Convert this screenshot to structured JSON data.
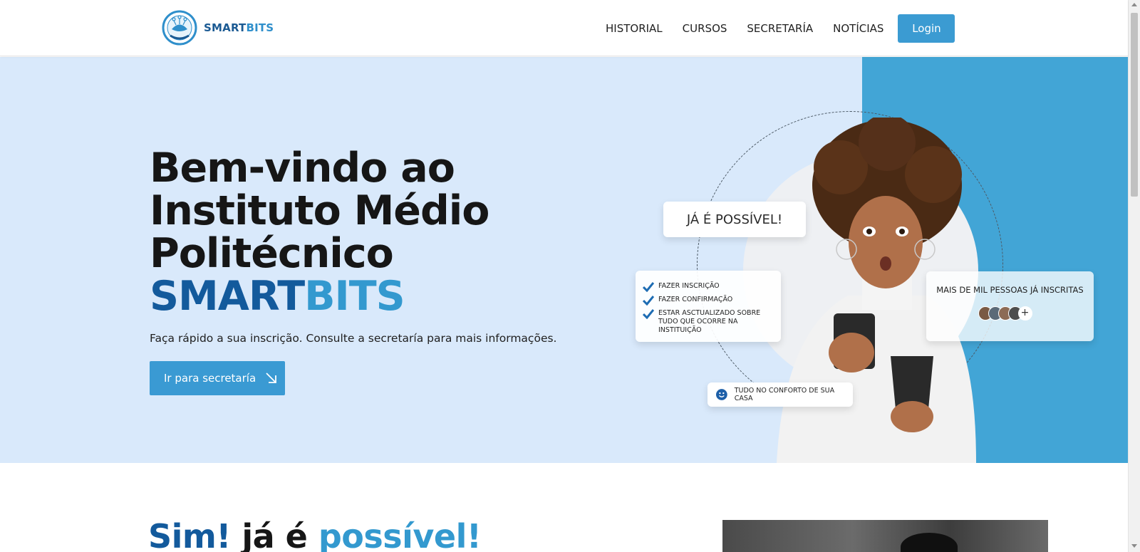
{
  "brand": {
    "name_part1": "SMART",
    "name_part2": "BITS",
    "logo_icon": "smartbits-logo-icon"
  },
  "nav": {
    "items": [
      "HISTORIAL",
      "CURSOS",
      "SECRETARÍA",
      "NOTÍCIAS"
    ],
    "login_label": "Login"
  },
  "hero": {
    "title_line1": "Bem-vindo ao",
    "title_line2": "Instituto Médio",
    "title_line3": "Politécnico",
    "title_smart": "SMART",
    "title_bits": "BITS",
    "subtitle": "Faça rápido a sua inscrição. Consulte a secretaría para mais informações.",
    "cta_label": "Ir para secretaría",
    "cta_icon": "arrow-down-right-icon"
  },
  "cards": {
    "possible": "JÁ É POSSÍVEL!",
    "steps": [
      "FAZER INSCRIÇÃO",
      "FAZER CONFIRMAÇÃO",
      "ESTAR ASCTUALIZADO SOBRE TUDO QUE OCORRE NA INSTITUIÇÃO"
    ],
    "people_label": "MAIS DE MIL PESSOAS JÁ INSCRITAS",
    "people_more": "+",
    "comfort": "TUDO NO CONFORTO DE SUA CASA"
  },
  "section2": {
    "word1": "Sim!",
    "word2": "já é",
    "word3": "possível!"
  },
  "colors": {
    "brand_dark": "#135a9c",
    "brand_light": "#3399cf",
    "button": "#3a9ad3",
    "hero_bg": "#d9e9fb",
    "hero_accent": "#42a5d6"
  }
}
